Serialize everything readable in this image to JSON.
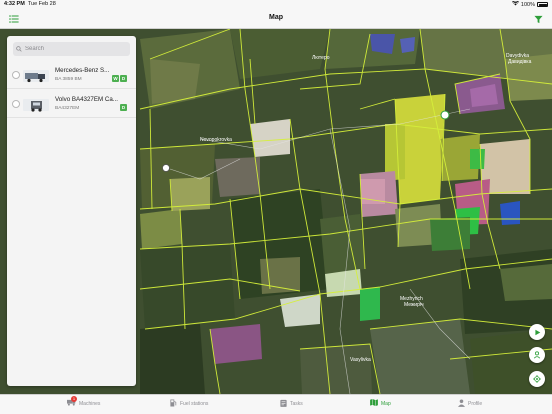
{
  "status": {
    "time": "4:32 PM",
    "date": "Tue Feb 28",
    "battery": "100%"
  },
  "header": {
    "title": "Map"
  },
  "search": {
    "placeholder": "Search"
  },
  "machines": [
    {
      "name": "Mercedes-Benz S...",
      "plate": "BA 3859 BM",
      "badges": [
        "W",
        "D"
      ]
    },
    {
      "name": "Volvo BA4327EM Ca...",
      "plate": "BA4327EM",
      "badges": [
        "D"
      ]
    }
  ],
  "map_labels": {
    "l1": "Лютеро",
    "l2": "Mezhyrich",
    "l3": "Межиріч",
    "l4": "Davydivka",
    "l5": "Давидівка",
    "l6": "Novopokrovka",
    "l7": "Vasylivka"
  },
  "tabs": [
    {
      "label": "Machines",
      "icon": "truck-icon",
      "badge": "1"
    },
    {
      "label": "Fuel stations",
      "icon": "fuel-pump-icon"
    },
    {
      "label": "Tasks",
      "icon": "clipboard-icon"
    },
    {
      "label": "Map",
      "icon": "map-icon",
      "active": true
    },
    {
      "label": "Profile",
      "icon": "person-icon"
    }
  ],
  "colors": {
    "accent": "#2e9e3a",
    "field_border": "#d6f03a",
    "badge_green": "#4caf50"
  }
}
